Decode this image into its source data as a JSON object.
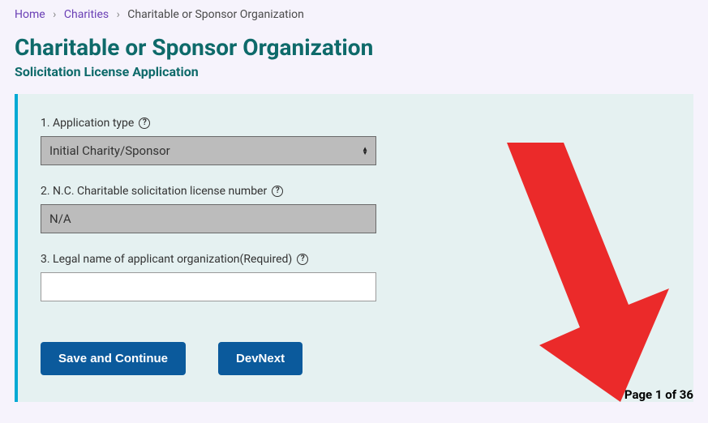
{
  "breadcrumb": {
    "home": "Home",
    "charities": "Charities",
    "current": "Charitable or Sponsor Organization"
  },
  "header": {
    "title": "Charitable or Sponsor Organization",
    "subtitle": "Solicitation License Application"
  },
  "form": {
    "q1": {
      "label": "1. Application type",
      "selected": "Initial Charity/Sponsor"
    },
    "q2": {
      "label": "2. N.C. Charitable solicitation license number",
      "value": "N/A"
    },
    "q3": {
      "label": "3. Legal name of applicant organization(Required)",
      "value": ""
    }
  },
  "buttons": {
    "save": "Save and Continue",
    "devnext": "DevNext"
  },
  "pager": {
    "text": "Page 1 of 36"
  }
}
